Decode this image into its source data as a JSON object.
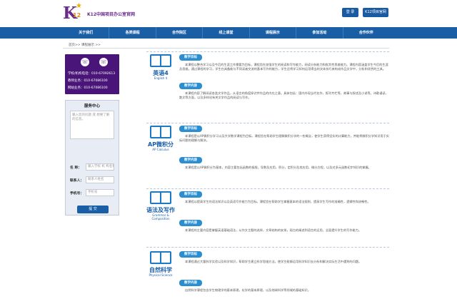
{
  "header": {
    "logo_main": "K",
    "logo_num": "12",
    "site_name": "K12中国项目办公室官网",
    "login_label": "登 录",
    "portal_label": "K12项目官网"
  },
  "nav": {
    "items": [
      "关于我们",
      "各类课程",
      "合作院区",
      "线上课堂",
      "课程展示",
      "参加活动",
      "合作伙伴"
    ]
  },
  "breadcrumb": "首页>> 课程展示 >>",
  "contact": {
    "school_tel": "学校/机构电话：010-67092613",
    "teacher_tel": "教师业务：010-67086100",
    "web_tel": "网站业务：010-67086100"
  },
  "service": {
    "title": "服务中心",
    "textarea_placeholder": "输入您的问题 或 想要了解的信息。",
    "name_label": "名  称：",
    "name_placeholder": "输入学校 机 构名称",
    "contact_label": "联系人：",
    "contact_placeholder": "联系人姓名",
    "phone_label": "手机号：",
    "phone_placeholder": "手机号",
    "submit_label": "提 交"
  },
  "courses": [
    {
      "title": "英语4",
      "subtitle": "English 4",
      "goal_label": "教学目标",
      "goal_text": "本课程以整合学习以及今后的生涯工作需要为目标。课程旨在加强学生的阅读和写作能力，阅读分析能力和批判性思维能力。课程内容涵盖学生今后的生涯及思维。通过课程的学习，学生在具备能与不同读者交流的基本写作的能力，学生还将学习如何运用得当的文体技巧来构成作品文学中，分析和欣赏的工具。",
      "content_label": "教学内容",
      "content_text": "本课程内容了解阅读各类文学作品，从语言的角度探讨并作品的内在之意。具体包括：国内外现当代名作，报刊专栏等，故事与叙述及小说等，诗歌诵读，散文等方面，以及多样化有关文学作品的阅读与写作。"
    },
    {
      "title": "AP微积分",
      "subtitle": "AP Calculus",
      "goal_label": "教学目标",
      "goal_text": "本课程是以AP微积分学习以及大学数学课程为目标。课程旨在帮助学生理解微积分学的一些概念，使学生获得坚实的计算能力，并能将微积分学知识用于实际问题的理解与解决。",
      "content_label": "教学内容",
      "content_text": "本课程是以AP微积分为基本，内容主要包括函数的极限，导数及应用，积分，定积分及其应用，微分方程，以及对多元函数初步知识的掌握。"
    },
    {
      "title": "语法及写作",
      "subtitle": "Grammar & Composition",
      "goal_label": "教学目标",
      "goal_text": "本课程以提高学生的语法知识以及英语写作能力为目标。课程旨在帮助学生掌握基本的语法规则，提高学生写作的准确性，逻辑性和流畅性。",
      "content_label": "教学内容",
      "content_text": "本课程的主要内容是掌握英语基础语法，从作文主题的选择，文章结构的安排，观点的阐述到语言的运用，全面提升学生的写作能力。"
    },
    {
      "title": "自然科学",
      "subtitle": "Physical Science",
      "goal_label": "教学目标",
      "goal_text": "本课程通过大量科学实验以及科学知识，帮助学生建立科学思维方法。使学生能够运用科学知识去分析和解决实际生活中遇到的问题。",
      "content_label": "教学内容",
      "content_text": "自然科学课程包含学生物理学的基本原理，化学的基本原理，以及地球科学等领域的基础知识。"
    }
  ]
}
